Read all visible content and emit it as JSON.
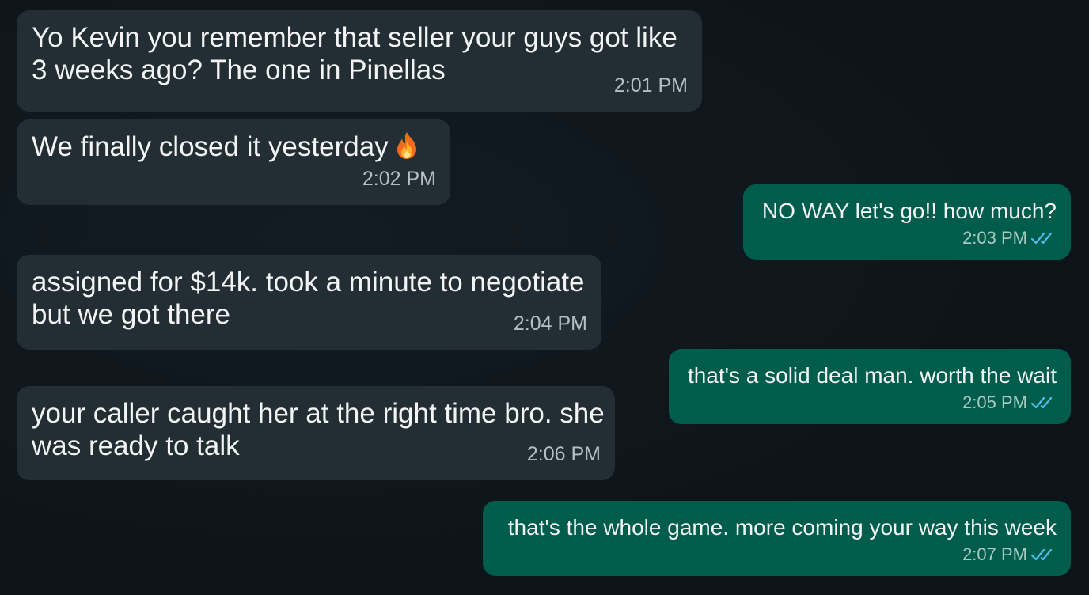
{
  "messages": [
    {
      "direction": "incoming",
      "lines": [
        "Yo Kevin you remember that seller your guys got like",
        "3 weeks ago? The one in Pinellas"
      ],
      "time": "2:01 PM"
    },
    {
      "direction": "incoming",
      "lines": [
        "We finally closed it yesterday"
      ],
      "emoji": "fire-emoji",
      "time": "2:02 PM"
    },
    {
      "direction": "outgoing",
      "lines": [
        "NO WAY let's go!! how much?"
      ],
      "time": "2:03 PM",
      "status": "read"
    },
    {
      "direction": "incoming",
      "lines": [
        "assigned for $14k. took a minute to negotiate",
        "but we got there"
      ],
      "time": "2:04 PM"
    },
    {
      "direction": "outgoing",
      "lines": [
        "that's a solid deal man. worth the wait"
      ],
      "time": "2:05 PM",
      "status": "read"
    },
    {
      "direction": "incoming",
      "lines": [
        "your caller caught her at the right time bro. she",
        "was ready to talk"
      ],
      "time": "2:06 PM"
    },
    {
      "direction": "outgoing",
      "lines": [
        "that's the whole game. more coming your way this week"
      ],
      "time": "2:07 PM",
      "status": "read"
    }
  ],
  "colors": {
    "background": "#0e151b",
    "incoming_bubble": "#222d34",
    "outgoing_bubble": "#005d4b",
    "read_ticks": "#53bdeb",
    "timestamp": "#b4bec4"
  },
  "icons": {
    "read_receipt": "double-check-icon",
    "fire": "fire-emoji"
  }
}
